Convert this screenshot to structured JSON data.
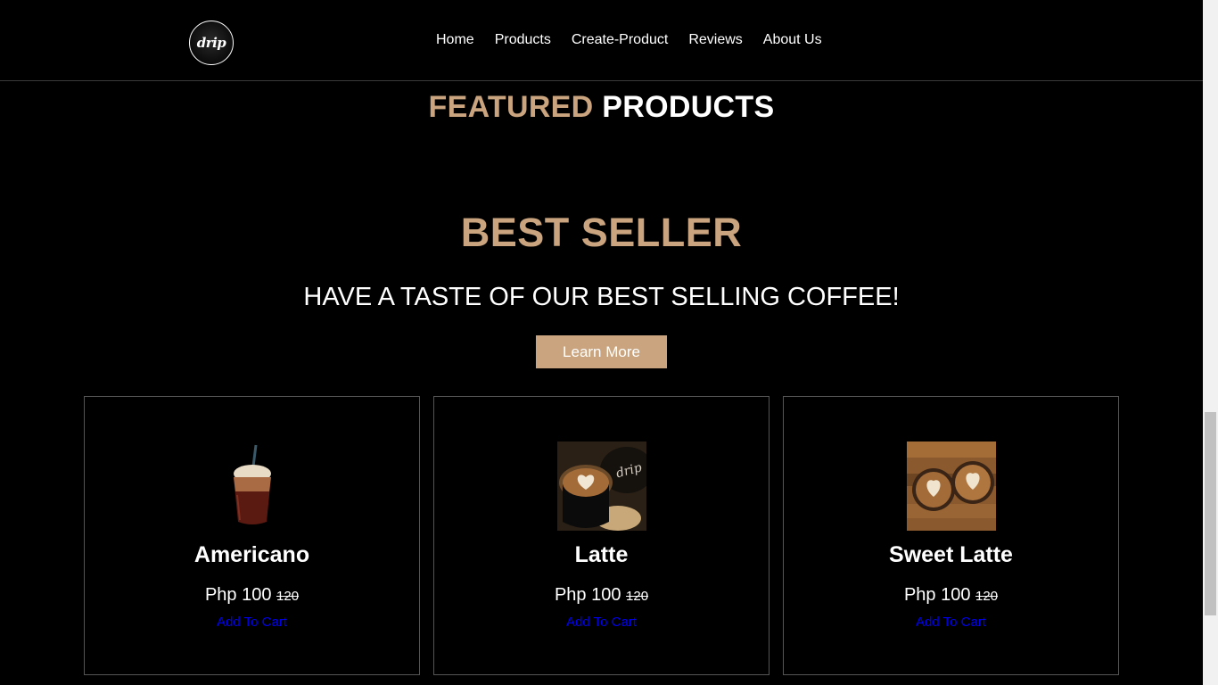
{
  "header": {
    "logo_text": "drip",
    "nav": [
      "Home",
      "Products",
      "Create-Product",
      "Reviews",
      "About Us"
    ]
  },
  "featured": {
    "accent": "FEATURED",
    "rest": "PRODUCTS"
  },
  "hero": {
    "title": "BEST SELLER",
    "subtitle": "HAVE A TASTE OF OUR BEST SELLING COFFEE!",
    "button": "Learn More"
  },
  "products": [
    {
      "name": "Americano",
      "price": "Php 100",
      "old_price": "120",
      "cart": "Add To Cart",
      "image": "iced-americano-cup-image"
    },
    {
      "name": "Latte",
      "price": "Php 100",
      "old_price": "120",
      "cart": "Add To Cart",
      "image": "latte-art-cup-image"
    },
    {
      "name": "Sweet Latte",
      "price": "Php 100",
      "old_price": "120",
      "cart": "Add To Cart",
      "image": "two-lattes-on-wood-image"
    }
  ],
  "colors": {
    "accent": "#c9a47e",
    "background": "#000000",
    "link": "#0000ee",
    "card_border": "#555555"
  }
}
